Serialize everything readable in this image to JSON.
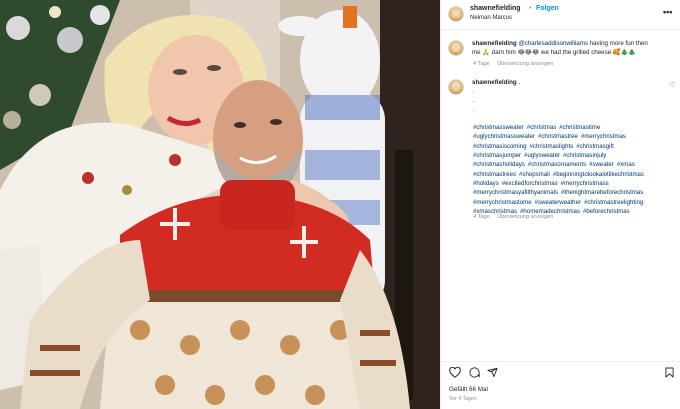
{
  "post": {
    "username": "shawnefielding",
    "follow_label": "Folgen",
    "location": "Neiman Marcus",
    "more_label": "•••"
  },
  "comments": [
    {
      "username": "shawnefielding",
      "mention": "@charlesaddisonwilliams",
      "text_a": " having more fun then",
      "text_b": "me ",
      "text_c": " darn him ",
      "text_d": " we had the grilled cheese ",
      "emoji_1": "🙏",
      "emoji_2": "😂😂😂",
      "emoji_3": "🥰🎄🎄",
      "time": "4 Tage",
      "translate": "Übersetzung anzeigen"
    },
    {
      "username": "shawnefielding",
      "text": ".",
      "dots": [
        ".",
        ".",
        "."
      ],
      "hashtags": [
        "#christmassweater",
        "#christmas",
        "#christmastime",
        "#uglychristmassweater",
        "#christmastree",
        "#merrychristmas",
        "#christmasiscoming",
        "#christmaslights",
        "#christmasgift",
        "#christmasjumper",
        "#uglysweater",
        "#christmasinjuly",
        "#christmasholidays",
        "#christmasornaments",
        "#sweater",
        "#xmas",
        "#christmastrees",
        "#shopsmall",
        "#beginningtolookalotlikechristmas",
        "#holidays",
        "#excitedforchristmas",
        "#merrychristmass",
        "#merrychristmasyafilthyanimals",
        "#thenightmarebeforechristmas",
        "#merrychristmastome",
        "#sweaterweather",
        "#christmastreelighting",
        "#xmaschristmas",
        "#homemadechristmas",
        "#beforechristmas"
      ],
      "time": "4 Tage",
      "translate": "Übersetzung anzeigen"
    }
  ],
  "footer": {
    "likes": "Gefällt 66 Mal",
    "ago": "Vor 4 Tagen"
  },
  "colors": {
    "link": "#00376b",
    "follow": "#0095f6",
    "meta": "#8e8e8e",
    "sweater_red": "#d12b22"
  },
  "icons": [
    "heart-icon",
    "comment-icon",
    "share-icon",
    "bookmark-icon",
    "more-icon"
  ]
}
